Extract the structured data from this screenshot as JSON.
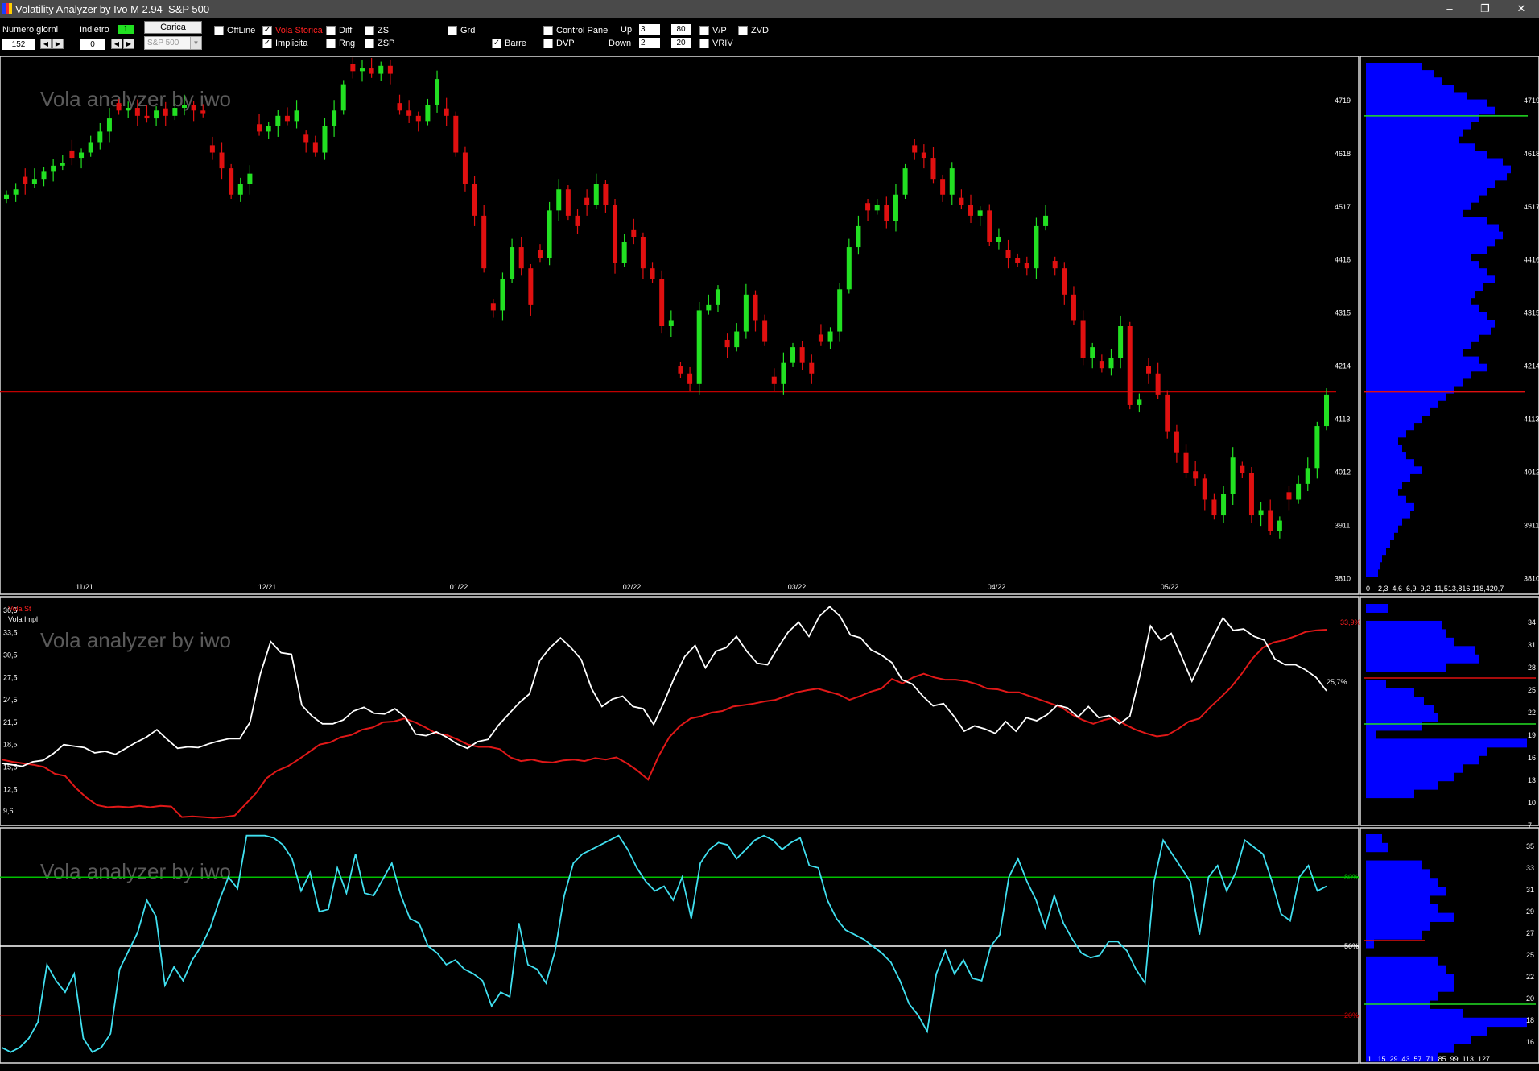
{
  "window": {
    "title": "Volatility Analyzer by Ivo M 2.94  S&P 500",
    "controls": [
      "minimize",
      "restore",
      "close"
    ]
  },
  "toolbar": {
    "numero_giorni_label": "Numero giorni",
    "numero_giorni_value": "152",
    "indietro_label": "Indietro",
    "indietro_value": "0",
    "indietro_indicator": "1",
    "carica_button": "Carica",
    "symbol_select": "S&P 500",
    "checkboxes": [
      {
        "label": "OffLine",
        "checked": false
      },
      {
        "label": "Vola Storica",
        "checked": true,
        "color": "#ff2020"
      },
      {
        "label": "Implicita",
        "checked": true
      },
      {
        "label": "Diff",
        "checked": false
      },
      {
        "label": "Rng",
        "checked": false
      },
      {
        "label": "ZS",
        "checked": false
      },
      {
        "label": "ZSP",
        "checked": false
      },
      {
        "label": "Grd",
        "checked": false
      },
      {
        "label": "Barre",
        "checked": true
      },
      {
        "label": "Control Panel",
        "checked": false
      },
      {
        "label": "DVP",
        "checked": false
      },
      {
        "label": "V/P",
        "checked": false
      },
      {
        "label": "VRIV",
        "checked": false
      },
      {
        "label": "ZVD",
        "checked": false
      }
    ],
    "up_label": "Up",
    "up_value": "3",
    "up_value2": "80",
    "down_label": "Down",
    "down_value": "2",
    "down_value2": "20"
  },
  "watermark": "Vola analyzer by iwo",
  "colors": {
    "bullish": "#22e022",
    "bearish": "#e01010",
    "histogram": "#0000ff",
    "hist_vola": "#ff2020",
    "impl_vola": "#ffffff",
    "percentile_line": "#40e0f0",
    "level_green": "#00c000",
    "level_red": "#d00000"
  },
  "price_panel": {
    "y_ticks": [
      "4719",
      "4618",
      "4517",
      "4416",
      "4315",
      "4214",
      "4113",
      "4012",
      "3911",
      "3810"
    ],
    "x_ticks": [
      "11/21",
      "12/21",
      "01/22",
      "02/22",
      "03/22",
      "04/22",
      "05/22"
    ],
    "reference_price": 4165,
    "histogram_green_level": 4690,
    "histogram_red_level": 4165,
    "histogram_x_ticks": "0    2,3  4,6  6,9  9,2  11,513,816,118,420,7"
  },
  "vola_panel": {
    "legend": [
      "Vola St",
      "Vola Impl"
    ],
    "y_ticks": [
      "36,5",
      "33,5",
      "30,5",
      "27,5",
      "24,5",
      "21,5",
      "18,5",
      "15,5",
      "12,5",
      "9,6"
    ],
    "last_hist_label": "33,9%",
    "last_impl_label": "25,7%",
    "histogram_y_ticks": [
      "34",
      "31",
      "28",
      "25",
      "22",
      "19",
      "16",
      "13",
      "10",
      "7"
    ]
  },
  "percentile_panel": {
    "levels": [
      80,
      50,
      20
    ],
    "level_labels": [
      "80%",
      "50%",
      "20%"
    ],
    "histogram_y_ticks": [
      "35",
      "33",
      "31",
      "29",
      "27",
      "25",
      "22",
      "20",
      "18",
      "16"
    ],
    "histogram_x_ticks": "1   15  29  43  57  71  85  99  113  127"
  },
  "chart_data": [
    {
      "type": "candlestick",
      "title": "S&P 500",
      "ylim": [
        3780,
        4800
      ],
      "y_ticks": [
        4719,
        4618,
        4517,
        4416,
        4315,
        4214,
        4113,
        4012,
        3911,
        3810
      ],
      "x_ticks": [
        "11/21",
        "12/21",
        "01/22",
        "02/22",
        "03/22",
        "04/22",
        "05/22"
      ],
      "bars": 152,
      "close_path": [
        4540,
        4550,
        4560,
        4570,
        4585,
        4595,
        4600,
        4610,
        4620,
        4640,
        4660,
        4685,
        4700,
        4705,
        4690,
        4685,
        4700,
        4690,
        4705,
        4710,
        4700,
        4695,
        4620,
        4590,
        4540,
        4560,
        4580,
        4660,
        4670,
        4690,
        4680,
        4700,
        4640,
        4620,
        4670,
        4700,
        4750,
        4775,
        4780,
        4770,
        4785,
        4770,
        4700,
        4690,
        4680,
        4710,
        4760,
        4690,
        4620,
        4560,
        4500,
        4400,
        4320,
        4380,
        4440,
        4400,
        4330,
        4420,
        4510,
        4550,
        4500,
        4480,
        4520,
        4560,
        4520,
        4410,
        4450,
        4460,
        4400,
        4380,
        4290,
        4300,
        4200,
        4180,
        4320,
        4330,
        4360,
        4250,
        4280,
        4350,
        4300,
        4260,
        4180,
        4220,
        4250,
        4220,
        4200,
        4260,
        4280,
        4360,
        4440,
        4480,
        4510,
        4520,
        4490,
        4540,
        4590,
        4620,
        4610,
        4570,
        4540,
        4590,
        4520,
        4500,
        4510,
        4450,
        4460,
        4420,
        4410,
        4400,
        4480,
        4500,
        4400,
        4350,
        4300,
        4230,
        4250,
        4210,
        4230,
        4290,
        4140,
        4150,
        4200,
        4160,
        4090,
        4050,
        4010,
        4000,
        3960,
        3930,
        3970,
        4040,
        4010,
        3930,
        3940,
        3900,
        3920,
        3960,
        3990,
        4020,
        4100,
        4160
      ]
    },
    {
      "type": "line",
      "title": "",
      "ylim": [
        8,
        38
      ],
      "series": [
        {
          "name": "Vola St",
          "values": [
            16.5,
            16.2,
            16,
            15.8,
            15.5,
            14.6,
            14.3,
            12.7,
            11.4,
            10.4,
            10.1,
            10.2,
            10.1,
            10.3,
            10.1,
            10.3,
            10.2,
            8.8,
            8.9,
            8.8,
            8.7,
            8.8,
            9,
            10.5,
            12,
            14,
            15,
            15.6,
            16.5,
            17.5,
            18.5,
            18.8,
            19.5,
            19.8,
            20.5,
            20.8,
            21.5,
            21.6,
            22,
            21.5,
            20.8,
            20,
            19.8,
            19.2,
            18.5,
            18.2,
            18.2,
            17.9,
            16.8,
            16.3,
            16.5,
            16.2,
            16.1,
            16.4,
            16.5,
            16.3,
            16.7,
            16.5,
            16.8,
            16,
            15,
            13.8,
            17,
            19.5,
            21,
            22,
            22.3,
            22.8,
            23,
            23.6,
            23.8,
            24,
            24.3,
            24.5,
            25,
            25.5,
            25.8,
            26,
            25.6,
            25.2,
            24.5,
            25,
            25.6,
            26,
            27.3,
            26.7,
            27.5,
            28,
            27.5,
            27.2,
            27.2,
            27,
            26.6,
            26,
            25.9,
            25.5,
            25.5,
            25,
            24.5,
            24,
            23.5,
            22.5,
            21.8,
            21.3,
            21.8,
            22.1,
            21.2,
            20.5,
            20,
            19.6,
            19.8,
            20.6,
            21.6,
            22,
            23.5,
            24.8,
            26.2,
            28,
            30,
            31.5,
            32.2,
            32.5,
            33,
            33.6,
            33.8,
            33.9
          ]
        },
        {
          "name": "Vola Impl",
          "values": [
            16,
            15.8,
            15.6,
            16.2,
            16.4,
            17.3,
            18.5,
            18.3,
            18.1,
            17.4,
            17.6,
            17.2,
            18,
            18.8,
            19.5,
            20.5,
            19.2,
            18,
            18.2,
            18.1,
            18.6,
            19,
            19.3,
            19.3,
            21.5,
            28,
            32.3,
            30.8,
            30.6,
            23.8,
            22.3,
            21.3,
            21.3,
            21.8,
            23,
            23.5,
            22.7,
            22.6,
            23.3,
            22.2,
            19.9,
            19.7,
            20.2,
            19.5,
            18.6,
            18,
            18.9,
            19.2,
            21.1,
            22.6,
            24.1,
            25.3,
            29.8,
            31.5,
            32.8,
            31.5,
            29.9,
            26,
            23.6,
            24.6,
            25,
            23.6,
            23.3,
            21.2,
            24.2,
            27.5,
            30.3,
            31.8,
            28.8,
            31,
            31.5,
            33,
            31,
            29.4,
            29.2,
            31.5,
            33.6,
            34.9,
            33,
            35.7,
            37,
            35.7,
            33.2,
            32.8,
            31.2,
            30.5,
            29.5,
            27.2,
            26.6,
            25,
            23.7,
            24,
            22.3,
            20.3,
            21,
            20.6,
            20,
            21.6,
            20.3,
            22.1,
            21.7,
            22.5,
            23.8,
            23.4,
            22.2,
            23.6,
            22.1,
            22.4,
            21.3,
            22.3,
            27.9,
            34.4,
            32.5,
            33.4,
            30.3,
            27,
            30,
            32.8,
            35.5,
            33.8,
            34,
            33,
            32.5,
            30,
            29.2,
            29.2,
            28.5,
            27.5,
            25.7
          ]
        }
      ],
      "last_values": [
        "33,9%",
        "25,7%"
      ]
    },
    {
      "type": "line",
      "title": "",
      "ylim": [
        0,
        100
      ],
      "levels": [
        80,
        50,
        20
      ],
      "series": [
        {
          "name": "",
          "values": [
            6,
            4,
            6,
            10,
            17,
            42,
            35,
            30,
            38,
            10,
            4,
            6,
            12,
            40,
            48,
            56,
            70,
            63,
            33,
            41,
            35,
            44,
            50,
            58,
            70,
            80,
            75,
            98,
            98,
            98,
            97,
            94,
            88,
            74,
            82,
            65,
            66,
            84,
            73,
            90,
            73,
            72,
            79,
            86,
            72,
            62,
            60,
            50,
            47,
            42,
            44,
            40,
            38,
            35,
            24,
            30,
            28,
            60,
            42,
            40,
            34,
            48,
            72,
            86,
            90,
            92,
            94,
            96,
            98,
            92,
            84,
            78,
            74,
            76,
            70,
            80,
            62,
            86,
            92,
            95,
            94,
            88,
            92,
            96,
            98,
            96,
            92,
            95,
            97,
            85,
            84,
            70,
            62,
            57,
            55,
            53,
            50,
            47,
            43,
            35,
            25,
            20,
            13,
            38,
            48,
            38,
            44,
            36,
            35,
            50,
            55,
            80,
            88,
            78,
            70,
            58,
            72,
            60,
            53,
            47,
            45,
            46,
            52,
            52,
            48,
            40,
            34,
            78,
            96,
            90,
            84,
            78,
            55,
            80,
            85,
            74,
            82,
            96,
            93,
            90,
            78,
            64,
            61,
            80,
            85,
            74,
            76
          ]
        }
      ]
    }
  ]
}
